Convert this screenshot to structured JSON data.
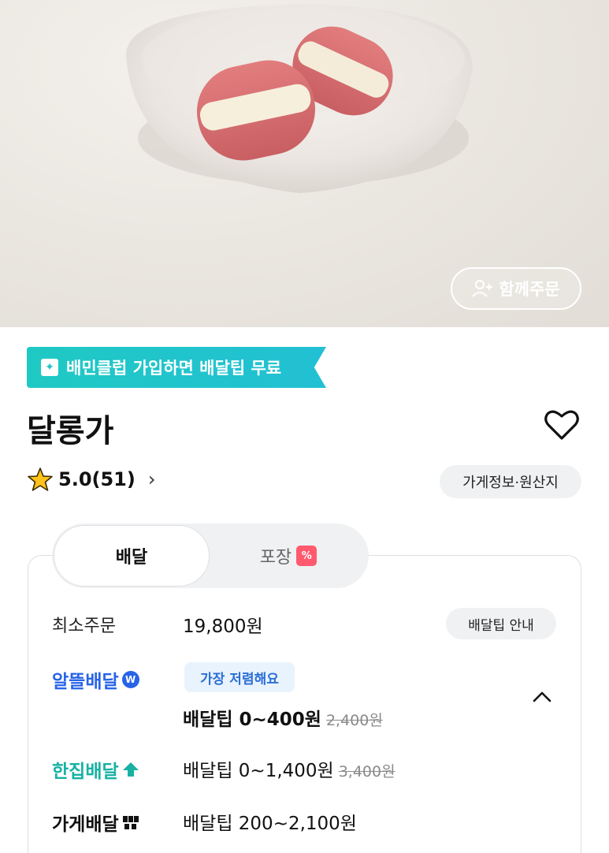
{
  "hero": {
    "together_order_label": "함께주문"
  },
  "club_banner": {
    "icon": "baemin-club-icon",
    "text": "배민클럽 가입하면 배달팁 무료"
  },
  "store": {
    "name": "달롱가",
    "rating": "5.0(51)",
    "info_chip": "가게정보·원산지"
  },
  "tabs": {
    "delivery": "배달",
    "takeout": "포장",
    "takeout_badge": "%"
  },
  "order": {
    "min_order_label": "최소주문",
    "min_order_value": "19,800원",
    "tip_guide_label": "배달팁 안내"
  },
  "delivery_options": {
    "saver": {
      "brand": "알뜰배달",
      "badge": "가장 저렴해요",
      "tip": "배달팁 0~400원",
      "original": "2,400원"
    },
    "single": {
      "brand": "한집배달",
      "tip": "배달팁 0~1,400원",
      "original": "3,400원"
    },
    "store_delivery": {
      "brand": "가게배달",
      "tip": "배달팁 200~2,100원"
    }
  },
  "colors": {
    "club": "#1fc9c3",
    "saver": "#2864e8",
    "single": "#17b2a3",
    "badge_bg": "#e8f3fd"
  }
}
